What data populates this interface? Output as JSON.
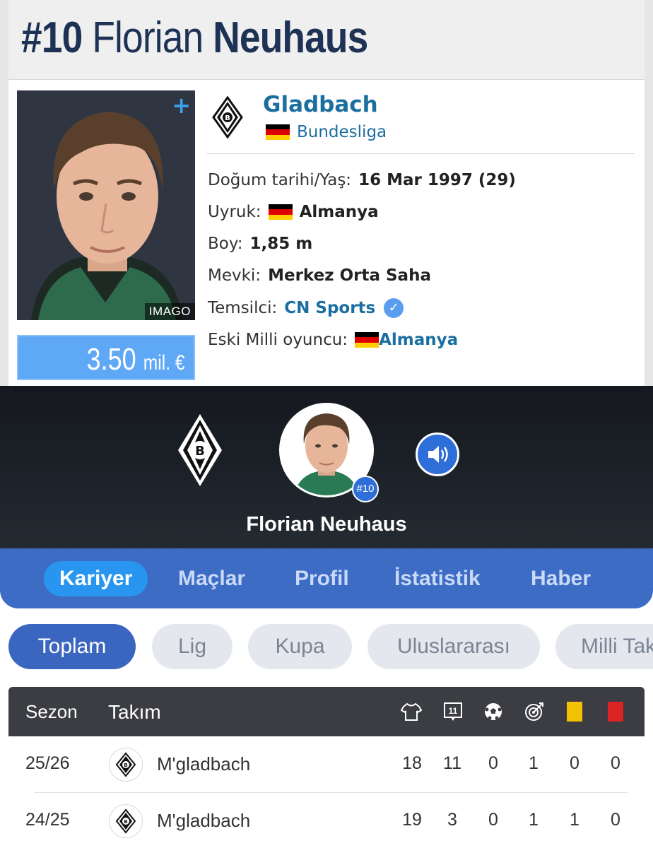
{
  "header": {
    "number": "#10",
    "first_name": "Florian",
    "last_name": "Neuhaus"
  },
  "photo": {
    "credit": "IMAGO",
    "plus": "+"
  },
  "market_value": {
    "amount": "3.50",
    "unit": "mil. €"
  },
  "club": {
    "name": "Gladbach",
    "league": "Bundesliga"
  },
  "info": {
    "birth_label": "Doğum tarihi/Yaş:",
    "birth_value": "16 Mar 1997 (29)",
    "citizenship_label": "Uyruk:",
    "citizenship_value": "Almanya",
    "height_label": "Boy:",
    "height_value": "1,85 m",
    "position_label": "Mevki:",
    "position_value": "Merkez Orta Saha",
    "agent_label": "Temsilci:",
    "agent_value": "CN Sports",
    "national_label": "Eski Milli oyuncu:",
    "national_value": "Almanya"
  },
  "player_card": {
    "badge": "#10",
    "name": "Florian Neuhaus"
  },
  "tabs": [
    {
      "label": "Kariyer"
    },
    {
      "label": "Maçlar"
    },
    {
      "label": "Profil"
    },
    {
      "label": "İstatistik"
    },
    {
      "label": "Haber"
    }
  ],
  "filters": [
    {
      "label": "Toplam"
    },
    {
      "label": "Lig"
    },
    {
      "label": "Kupa"
    },
    {
      "label": "Uluslararası"
    },
    {
      "label": "Milli Takım"
    }
  ],
  "table": {
    "col_season": "Sezon",
    "col_team": "Takım",
    "icons": [
      "jersey-icon",
      "lineup-icon",
      "ball-icon",
      "assist-target-icon",
      "yellow-card-icon",
      "red-card-icon"
    ],
    "rows": [
      {
        "season": "25/26",
        "team": "M'gladbach",
        "apps": "18",
        "starts": "11",
        "goals": "0",
        "assists": "1",
        "yellow": "0",
        "red": "0"
      },
      {
        "season": "24/25",
        "team": "M'gladbach",
        "apps": "19",
        "starts": "3",
        "goals": "0",
        "assists": "1",
        "yellow": "1",
        "red": "0"
      }
    ]
  },
  "colors": {
    "title": "#1d3254",
    "link": "#1a6ea0",
    "value_box": "#5fa8f5",
    "tab_bar": "#3d6cc4",
    "tab_active": "#2896f0",
    "chip_active": "#3a66c0",
    "table_head": "#3b3d42",
    "yellow_card": "#f2c200",
    "red_card": "#dd2424"
  }
}
